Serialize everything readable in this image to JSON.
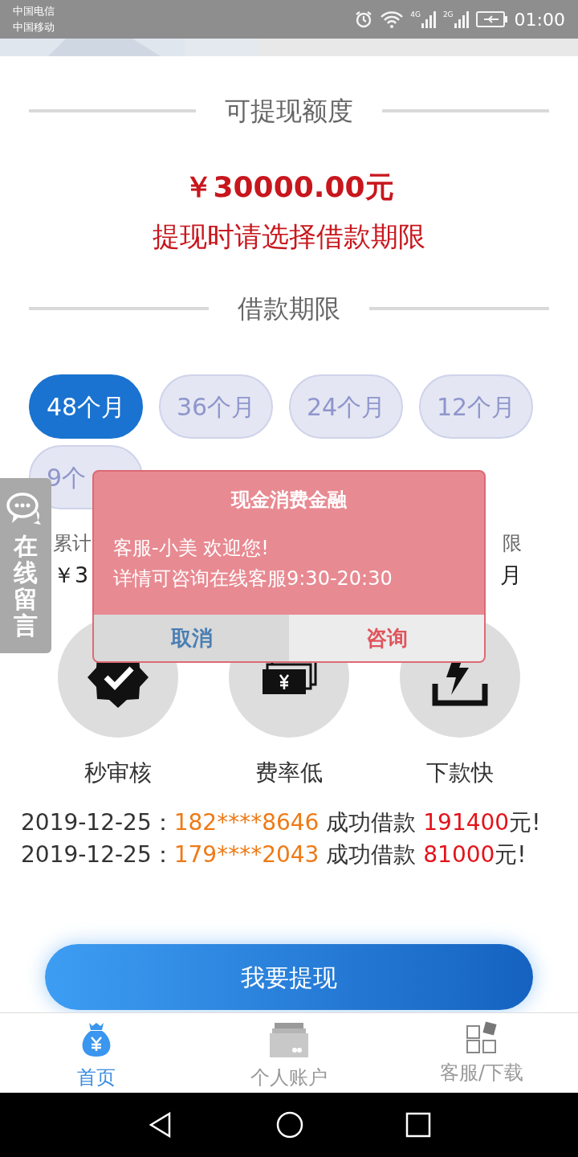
{
  "status_bar": {
    "carriers": [
      "中国电信",
      "中国移动"
    ],
    "net_1": "4G",
    "net_2": "2G",
    "time": "01:00"
  },
  "withdraw_heading": "可提现额度",
  "amount": "￥30000.00元",
  "hint": "提现时请选择借款期限",
  "term_heading": "借款期限",
  "terms": [
    {
      "label": "48个月",
      "selected": true
    },
    {
      "label": "36个月",
      "selected": false
    },
    {
      "label": "24个月",
      "selected": false
    },
    {
      "label": "12个月",
      "selected": false
    },
    {
      "label": "9个",
      "selected": false
    }
  ],
  "summary": {
    "column_1": {
      "label": "累计",
      "value": "￥3"
    },
    "column_3": {
      "label": "限",
      "value": "月"
    }
  },
  "features": [
    {
      "kind": "badge",
      "label": "秒审核"
    },
    {
      "kind": "cash",
      "label": "费率低"
    },
    {
      "kind": "flash",
      "label": "下款快"
    }
  ],
  "ticker": [
    {
      "date": "2019-12-25：",
      "phone": "182****8646",
      "text": "成功借款",
      "amount": "191400",
      "unit": "元!"
    },
    {
      "date": "2019-12-25：",
      "phone": "179****2043",
      "text": "成功借款",
      "amount": "81000",
      "unit": "元!"
    }
  ],
  "primary_button": "我要提现",
  "tab_bar": [
    {
      "kind": "bag",
      "label": "首页",
      "selected": true
    },
    {
      "kind": "wallet",
      "label": "个人账户",
      "selected": false
    },
    {
      "kind": "grid",
      "label": "客服/下载",
      "selected": false
    }
  ],
  "side_tab": {
    "label": "在线留言"
  },
  "dialog": {
    "title": "现金消费金融",
    "lines": [
      "客服-小美 欢迎您!",
      "详情可咨询在线客服9:30-20:30"
    ],
    "buttons": [
      {
        "label": "取消",
        "kind": "cancel"
      },
      {
        "label": "咨询",
        "kind": "confirm"
      }
    ]
  }
}
